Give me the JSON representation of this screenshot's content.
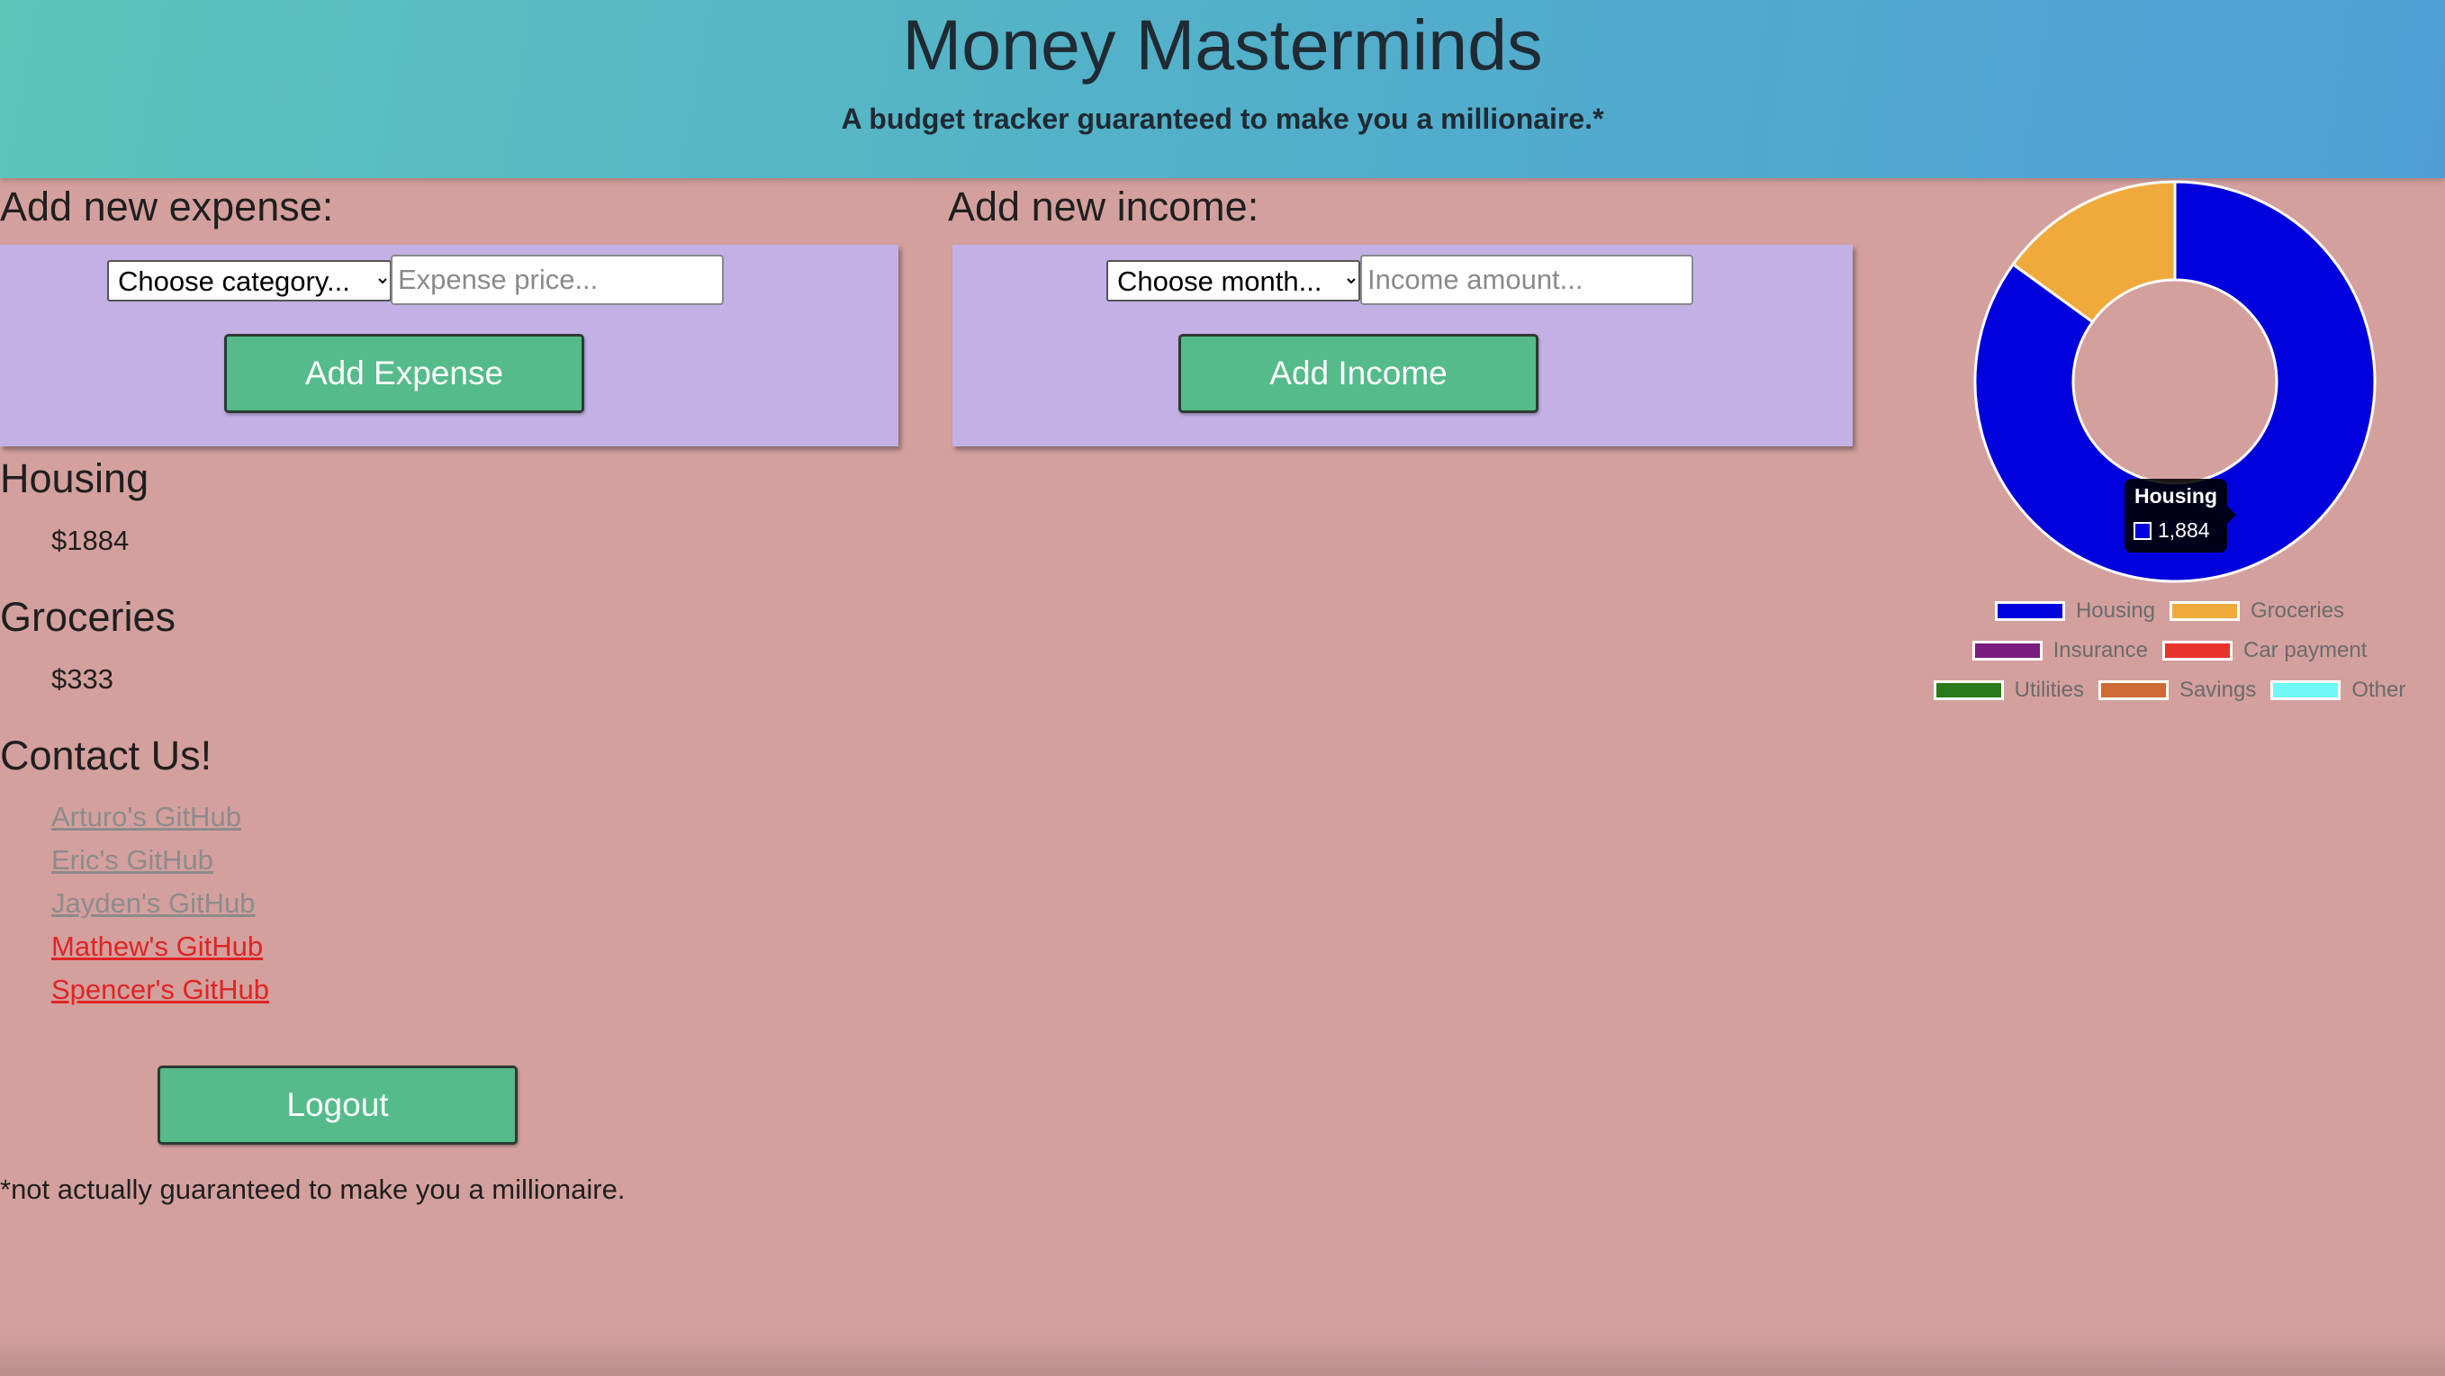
{
  "header": {
    "title": "Money Masterminds",
    "subtitle": "A budget tracker guaranteed to make you a millionaire.*"
  },
  "expense_form": {
    "heading": "Add new expense:",
    "category_select": "Choose category...",
    "price_placeholder": "Expense price...",
    "button_label": "Add Expense"
  },
  "income_form": {
    "heading": "Add new income:",
    "month_select": "Choose month...",
    "amount_placeholder": "Income amount...",
    "button_label": "Add Income"
  },
  "expenses": [
    {
      "category": "Housing",
      "amount": "$1884"
    },
    {
      "category": "Groceries",
      "amount": "$333"
    }
  ],
  "contact": {
    "heading": "Contact Us!",
    "links": [
      {
        "label": "Arturo's GitHub",
        "state": "visited"
      },
      {
        "label": "Eric's GitHub",
        "state": "visited"
      },
      {
        "label": "Jayden's GitHub",
        "state": "visited"
      },
      {
        "label": "Mathew's GitHub",
        "state": "unvisited"
      },
      {
        "label": "Spencer's GitHub",
        "state": "unvisited"
      }
    ]
  },
  "logout_label": "Logout",
  "footnote": "*not actually guaranteed to make you a millionaire.",
  "colors": {
    "header_gradient_start": "#5cc4bb",
    "header_gradient_end": "#4f9fd6",
    "page_background": "#d4a09e",
    "panel_background": "#c3b1e6",
    "button_green": "#55bb8b"
  },
  "chart_data": {
    "type": "doughnut",
    "categories": [
      "Housing",
      "Groceries",
      "Insurance",
      "Car payment",
      "Utilities",
      "Savings",
      "Other"
    ],
    "values": [
      1884,
      333,
      0,
      0,
      0,
      0,
      0
    ],
    "colors": [
      "#0000dd",
      "#f0aa3c",
      "#7a1c7e",
      "#e8322c",
      "#2a7a1c",
      "#cd6b35",
      "#6ff7f7"
    ],
    "legend_position": "bottom",
    "tooltip": {
      "title": "Housing",
      "value": "1,884"
    }
  }
}
